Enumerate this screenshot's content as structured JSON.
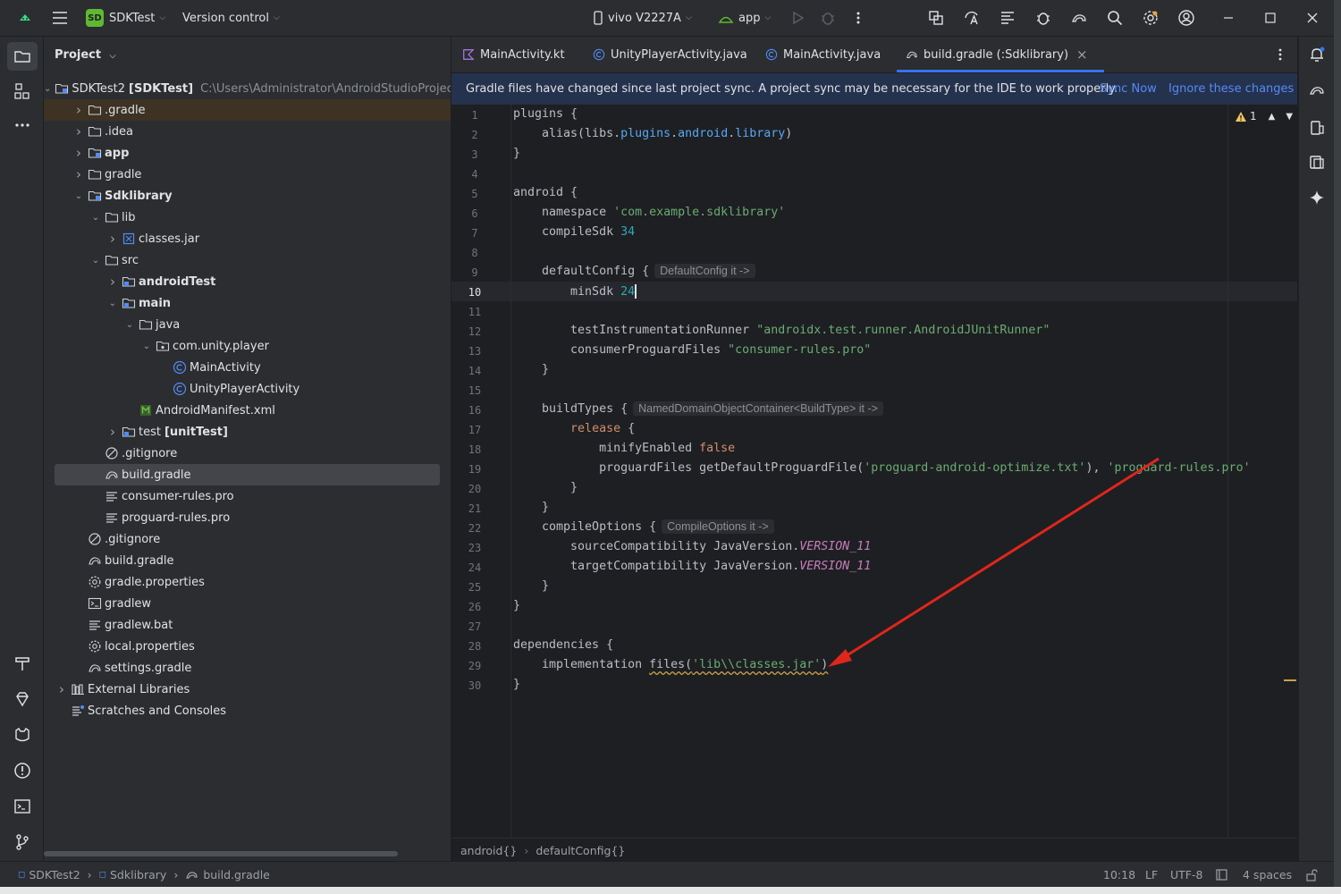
{
  "titlebar": {
    "project_badge": "SD",
    "project_name": "SDKTest",
    "vcs": "Version control",
    "device": "vivo V2227A",
    "run_config": "app"
  },
  "project_panel": {
    "title": "Project",
    "tree": [
      {
        "label": "SDKTest2",
        "bracket": "[SDKTest]",
        "path": "C:\\Users\\Administrator\\AndroidStudioProjects\\S",
        "indent": 0,
        "arrow": "open",
        "icon": "module",
        "bold": false
      },
      {
        "label": ".gradle",
        "indent": 1,
        "arrow": "closed",
        "icon": "folder",
        "bold": false
      },
      {
        "label": ".idea",
        "indent": 1,
        "arrow": "closed",
        "icon": "folder",
        "bold": false
      },
      {
        "label": "app",
        "indent": 1,
        "arrow": "closed",
        "icon": "module",
        "bold": true
      },
      {
        "label": "gradle",
        "indent": 1,
        "arrow": "closed",
        "icon": "folder",
        "bold": false
      },
      {
        "label": "Sdklibrary",
        "indent": 1,
        "arrow": "open",
        "icon": "module",
        "bold": true
      },
      {
        "label": "lib",
        "indent": 2,
        "arrow": "open",
        "icon": "folder",
        "bold": false
      },
      {
        "label": "classes.jar",
        "indent": 3,
        "arrow": "closed",
        "icon": "jar",
        "bold": false
      },
      {
        "label": "src",
        "indent": 2,
        "arrow": "open",
        "icon": "folder",
        "bold": false
      },
      {
        "label": "androidTest",
        "indent": 3,
        "arrow": "closed",
        "icon": "srcfolder",
        "bold": true
      },
      {
        "label": "main",
        "indent": 3,
        "arrow": "open",
        "icon": "srcfolder",
        "bold": true
      },
      {
        "label": "java",
        "indent": 4,
        "arrow": "open",
        "icon": "folder",
        "bold": false
      },
      {
        "label": "com.unity.player",
        "indent": 5,
        "arrow": "open",
        "icon": "package",
        "bold": false
      },
      {
        "label": "MainActivity",
        "indent": 6,
        "arrow": "none",
        "icon": "class",
        "bold": false
      },
      {
        "label": "UnityPlayerActivity",
        "indent": 6,
        "arrow": "none",
        "icon": "class",
        "bold": false
      },
      {
        "label": "AndroidManifest.xml",
        "indent": 4,
        "arrow": "none",
        "icon": "manifest",
        "bold": false
      },
      {
        "label": "test",
        "bracket": "[unitTest]",
        "indent": 3,
        "arrow": "closed",
        "icon": "srcfolder",
        "bold": false
      },
      {
        "label": ".gitignore",
        "indent": 2,
        "arrow": "none",
        "icon": "ignore",
        "bold": false
      },
      {
        "label": "build.gradle",
        "indent": 2,
        "arrow": "none",
        "icon": "gradle",
        "bold": false,
        "selected": true
      },
      {
        "label": "consumer-rules.pro",
        "indent": 2,
        "arrow": "none",
        "icon": "text",
        "bold": false
      },
      {
        "label": "proguard-rules.pro",
        "indent": 2,
        "arrow": "none",
        "icon": "text",
        "bold": false
      },
      {
        "label": ".gitignore",
        "indent": 1,
        "arrow": "none",
        "icon": "ignore",
        "bold": false
      },
      {
        "label": "build.gradle",
        "indent": 1,
        "arrow": "none",
        "icon": "gradle",
        "bold": false
      },
      {
        "label": "gradle.properties",
        "indent": 1,
        "arrow": "none",
        "icon": "settings",
        "bold": false
      },
      {
        "label": "gradlew",
        "indent": 1,
        "arrow": "none",
        "icon": "terminal",
        "bold": false
      },
      {
        "label": "gradlew.bat",
        "indent": 1,
        "arrow": "none",
        "icon": "text",
        "bold": false
      },
      {
        "label": "local.properties",
        "indent": 1,
        "arrow": "none",
        "icon": "settings",
        "bold": false
      },
      {
        "label": "settings.gradle",
        "indent": 1,
        "arrow": "none",
        "icon": "gradle",
        "bold": false
      },
      {
        "label": "External Libraries",
        "indent": 0,
        "arrow": "closed",
        "icon": "library",
        "bold": false
      },
      {
        "label": "Scratches and Consoles",
        "indent": 0,
        "arrow": "none",
        "icon": "scratch",
        "bold": false
      }
    ]
  },
  "tabs": [
    {
      "label": "MainActivity.kt",
      "icon": "kotlin",
      "active": false
    },
    {
      "label": "UnityPlayerActivity.java",
      "icon": "class",
      "active": false
    },
    {
      "label": "MainActivity.java",
      "icon": "class",
      "active": false
    },
    {
      "label": "build.gradle (:Sdklibrary)",
      "icon": "gradle",
      "active": true
    }
  ],
  "banner": {
    "message": "Gradle files have changed since last project sync. A project sync may be necessary for the IDE to work properly.",
    "sync_now": "Sync Now",
    "ignore": "Ignore these changes"
  },
  "editor": {
    "warning_count": "1",
    "current_line": 10,
    "lines": [
      {
        "n": "1",
        "segs": [
          [
            "p",
            "plugins "
          ],
          [
            "p",
            "{"
          ]
        ]
      },
      {
        "n": "2",
        "segs": [
          [
            "p",
            "    alias(libs."
          ],
          [
            "fn",
            "plugins"
          ],
          [
            "p",
            "."
          ],
          [
            "fn",
            "android"
          ],
          [
            "p",
            "."
          ],
          [
            "fn",
            "library"
          ],
          [
            "p",
            ")"
          ]
        ]
      },
      {
        "n": "3",
        "segs": [
          [
            "p",
            "}"
          ]
        ]
      },
      {
        "n": "4",
        "segs": []
      },
      {
        "n": "5",
        "segs": [
          [
            "p",
            "android {"
          ]
        ]
      },
      {
        "n": "6",
        "segs": [
          [
            "p",
            "    namespace "
          ],
          [
            "str",
            "'com.example.sdklibrary'"
          ]
        ]
      },
      {
        "n": "7",
        "segs": [
          [
            "p",
            "    compileSdk "
          ],
          [
            "num",
            "34"
          ]
        ]
      },
      {
        "n": "8",
        "segs": []
      },
      {
        "n": "9",
        "segs": [
          [
            "p",
            "    defaultConfig {"
          ],
          [
            "hint",
            "DefaultConfig it ->"
          ]
        ]
      },
      {
        "n": "10",
        "segs": [
          [
            "p",
            "        minSdk "
          ],
          [
            "num",
            "24"
          ]
        ]
      },
      {
        "n": "11",
        "segs": []
      },
      {
        "n": "12",
        "segs": [
          [
            "p",
            "        testInstrumentationRunner "
          ],
          [
            "str",
            "\"androidx.test.runner.AndroidJUnitRunner\""
          ]
        ]
      },
      {
        "n": "13",
        "segs": [
          [
            "p",
            "        consumerProguardFiles "
          ],
          [
            "str",
            "\"consumer-rules.pro\""
          ]
        ]
      },
      {
        "n": "14",
        "segs": [
          [
            "p",
            "    }"
          ]
        ]
      },
      {
        "n": "15",
        "segs": []
      },
      {
        "n": "16",
        "segs": [
          [
            "p",
            "    buildTypes {"
          ],
          [
            "hint",
            "NamedDomainObjectContainer<BuildType> it ->"
          ]
        ]
      },
      {
        "n": "17",
        "segs": [
          [
            "p",
            "        "
          ],
          [
            "kw",
            "release"
          ],
          [
            "p",
            " {"
          ]
        ]
      },
      {
        "n": "18",
        "segs": [
          [
            "p",
            "            minifyEnabled "
          ],
          [
            "kw",
            "false"
          ]
        ]
      },
      {
        "n": "19",
        "segs": [
          [
            "p",
            "            proguardFiles getDefaultProguardFile("
          ],
          [
            "str",
            "'proguard-android-optimize.txt'"
          ],
          [
            "p",
            "), "
          ],
          [
            "str",
            "'proguard-rules.pro'"
          ]
        ]
      },
      {
        "n": "20",
        "segs": [
          [
            "p",
            "        }"
          ]
        ]
      },
      {
        "n": "21",
        "segs": [
          [
            "p",
            "    }"
          ]
        ]
      },
      {
        "n": "22",
        "segs": [
          [
            "p",
            "    compileOptions {"
          ],
          [
            "hint",
            "CompileOptions it ->"
          ]
        ]
      },
      {
        "n": "23",
        "segs": [
          [
            "p",
            "        sourceCompatibility JavaVersion."
          ],
          [
            "const",
            "VERSION_11"
          ]
        ]
      },
      {
        "n": "24",
        "segs": [
          [
            "p",
            "        targetCompatibility JavaVersion."
          ],
          [
            "const",
            "VERSION_11"
          ]
        ]
      },
      {
        "n": "25",
        "segs": [
          [
            "p",
            "    }"
          ]
        ]
      },
      {
        "n": "26",
        "segs": [
          [
            "p",
            "}"
          ]
        ]
      },
      {
        "n": "27",
        "segs": []
      },
      {
        "n": "28",
        "segs": [
          [
            "p",
            "dependencies {"
          ]
        ]
      },
      {
        "n": "29",
        "segs": [
          [
            "p",
            "    implementation "
          ],
          [
            "squig",
            "files("
          ],
          [
            "sqstr",
            "'lib\\\\classes.jar'"
          ],
          [
            "squig",
            ")"
          ]
        ]
      },
      {
        "n": "30",
        "segs": [
          [
            "p",
            "}"
          ]
        ]
      }
    ]
  },
  "code_breadcrumb": [
    "android{}",
    "defaultConfig{}"
  ],
  "statusbar": {
    "breadcrumb": [
      "SDKTest2",
      "Sdklibrary",
      "build.gradle"
    ],
    "position": "10:18",
    "line_sep": "LF",
    "encoding": "UTF-8",
    "indent": "4 spaces"
  },
  "colors": {
    "background": "#1e1f22",
    "panel": "#2b2d30",
    "accent": "#3574f0",
    "banner": "#25324d",
    "annotation_arrow": "#e0261b"
  }
}
